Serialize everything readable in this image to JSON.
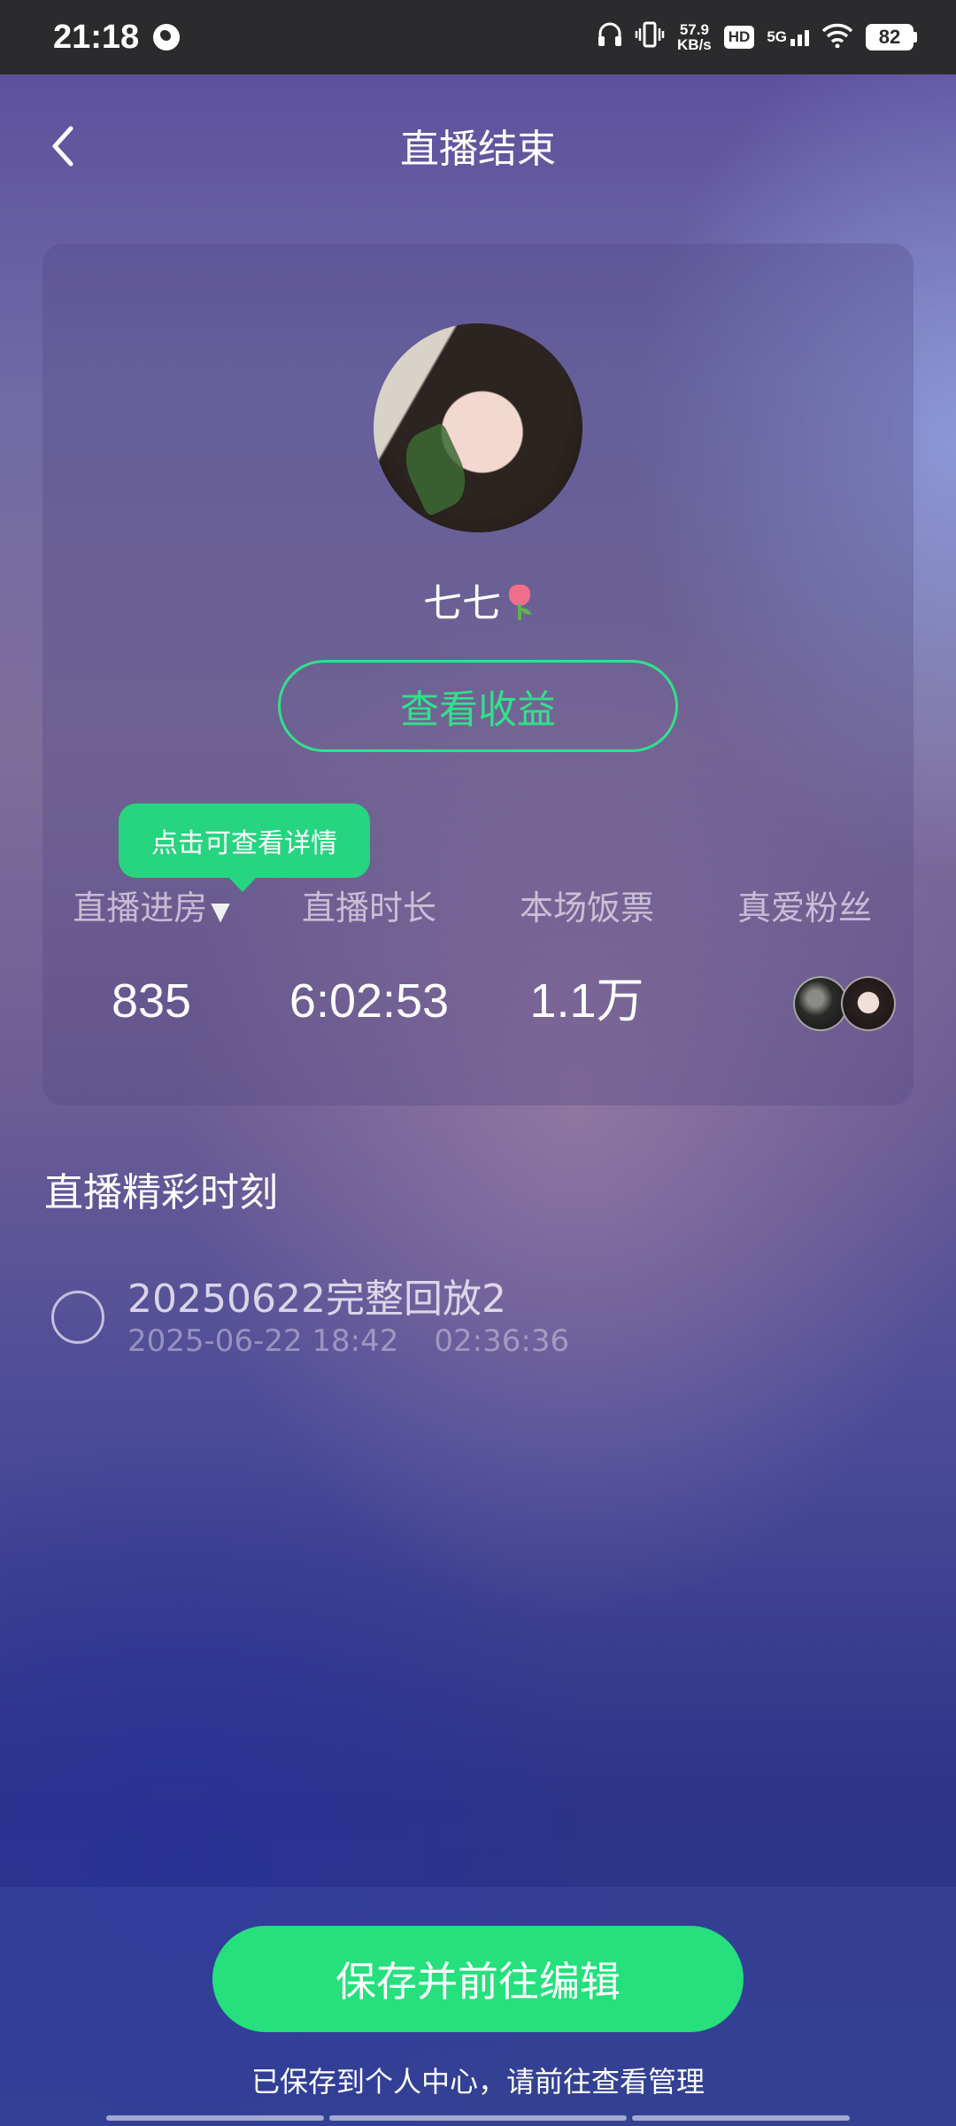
{
  "status_bar": {
    "time": "21:18",
    "net_speed_value": "57.9",
    "net_speed_unit": "KB/s",
    "hd_label": "HD",
    "network_label": "5G",
    "battery_level": "82"
  },
  "header": {
    "title": "直播结束"
  },
  "profile": {
    "name": "七七",
    "earnings_button": "查看收益"
  },
  "tooltip": {
    "text": "点击可查看详情"
  },
  "stats": [
    {
      "label": "直播进房",
      "value": "835"
    },
    {
      "label": "直播时长",
      "value": "6:02:53"
    },
    {
      "label": "本场饭票",
      "value": "1.1万"
    },
    {
      "label": "真爱粉丝",
      "value": ""
    }
  ],
  "highlights": {
    "section_title": "直播精彩时刻",
    "items": [
      {
        "title": "20250622完整回放2",
        "datetime": "2025-06-22 18:42",
        "duration": "02:36:36",
        "selected": false
      }
    ]
  },
  "footer": {
    "save_button": "保存并前往编辑",
    "note": "已保存到个人中心，请前往查看管理"
  },
  "colors": {
    "accent_green": "#25e07c",
    "status_bar_bg": "#2b2b2d"
  }
}
